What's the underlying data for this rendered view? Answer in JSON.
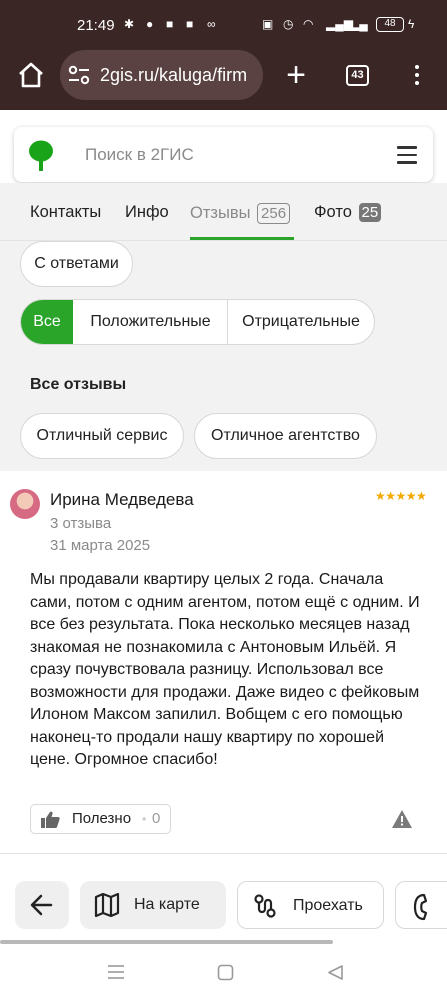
{
  "status_bar": {
    "time": "21:49",
    "battery": "48"
  },
  "browser": {
    "url": "2gis.ru/kaluga/firm",
    "tab_count": "43"
  },
  "search": {
    "placeholder": "Поиск в 2ГИС"
  },
  "tabs": [
    {
      "label": "Контакты",
      "count": ""
    },
    {
      "label": "Инфо",
      "count": ""
    },
    {
      "label": "Отзывы",
      "count": "256",
      "active": true
    },
    {
      "label": "Фото",
      "count": "25"
    }
  ],
  "filters": {
    "with_answers": "С ответами",
    "segment": [
      "Все",
      "Положительные",
      "Отрицательные"
    ],
    "segment_selected": "Все",
    "section_title": "Все отзывы",
    "tags": [
      "Отличный сервис",
      "Отличное агентство"
    ]
  },
  "review": {
    "author": "Ирина Медведева",
    "rating": 5,
    "stars": "★★★★★",
    "reviews_count": "3 отзыва",
    "date": "31 марта 2025",
    "text": "Мы продавали квартиру целых 2 года. Сначала сами, потом с одним агентом, потом ещё с одним. И все без результата. Пока несколько месяцев назад знакомая не познакомила с Антоновым Ильёй. Я сразу почувствовала разницу. Использовал все возможности для продажи. Даже видео с фейковым Илоном Максом запилил. Вобщем с его помощью наконец-то продали нашу квартиру по хорошей цене. Огромное спасибо!",
    "helpful_label": "Полезно",
    "helpful_count": "0"
  },
  "bottom_bar": {
    "map_label": "На карте",
    "route_label": "Проехать"
  },
  "colors": {
    "accent": "#2aa52a",
    "chrome": "#3b2626",
    "star": "#f2a900"
  }
}
